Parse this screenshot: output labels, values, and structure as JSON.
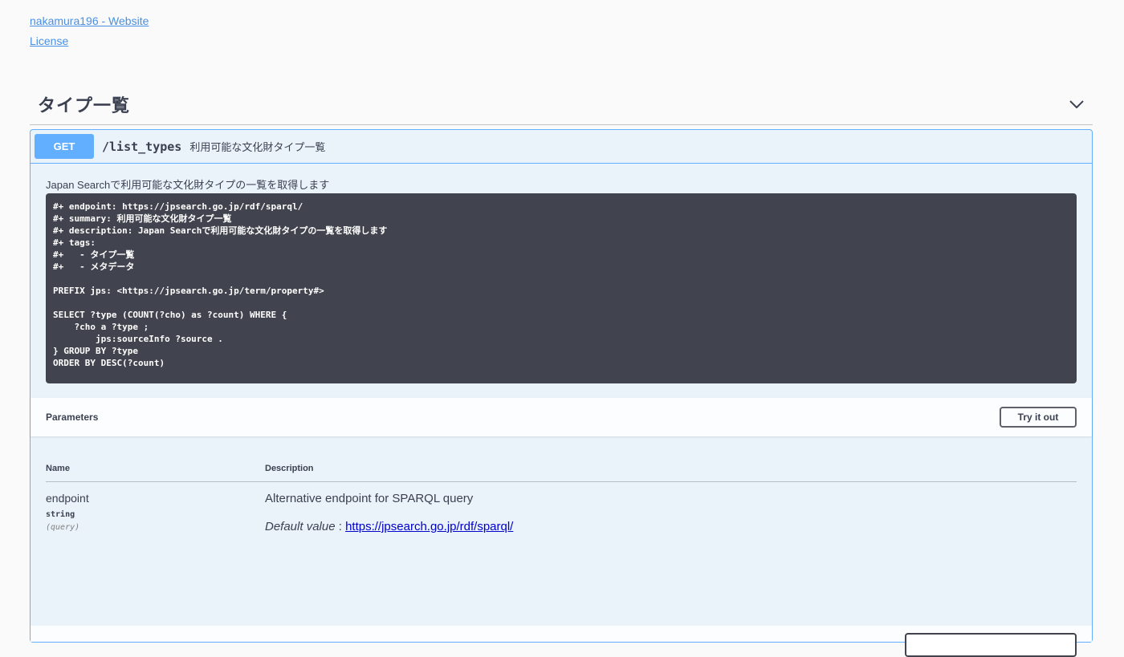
{
  "info": {
    "website_link": "nakamura196 - Website",
    "license_link": "License"
  },
  "tag": {
    "title": "タイプ一覧"
  },
  "operation": {
    "method": "GET",
    "path": "/list_types",
    "summary": "利用可能な文化財タイプ一覧",
    "description": "Japan Searchで利用可能な文化財タイプの一覧を取得します",
    "code": "#+ endpoint: https://jpsearch.go.jp/rdf/sparql/\n#+ summary: 利用可能な文化財タイプ一覧\n#+ description: Japan Searchで利用可能な文化財タイプの一覧を取得します\n#+ tags:\n#+   - タイプ一覧\n#+   - メタデータ\n\nPREFIX jps: <https://jpsearch.go.jp/term/property#>\n\nSELECT ?type (COUNT(?cho) as ?count) WHERE {\n    ?cho a ?type ;\n        jps:sourceInfo ?source .\n} GROUP BY ?type\nORDER BY DESC(?count)"
  },
  "parameters": {
    "title": "Parameters",
    "try_label": "Try it out",
    "col_name": "Name",
    "col_description": "Description",
    "rows": [
      {
        "name": "endpoint",
        "type": "string",
        "in": "(query)",
        "description": "Alternative endpoint for SPARQL query",
        "default_label": "Default value",
        "default_sep": " : ",
        "default_value": "https://jpsearch.go.jp/rdf/sparql/"
      }
    ]
  },
  "colors": {
    "get_accent": "#61affe",
    "code_bg": "#41444e",
    "link": "#4990e2"
  }
}
